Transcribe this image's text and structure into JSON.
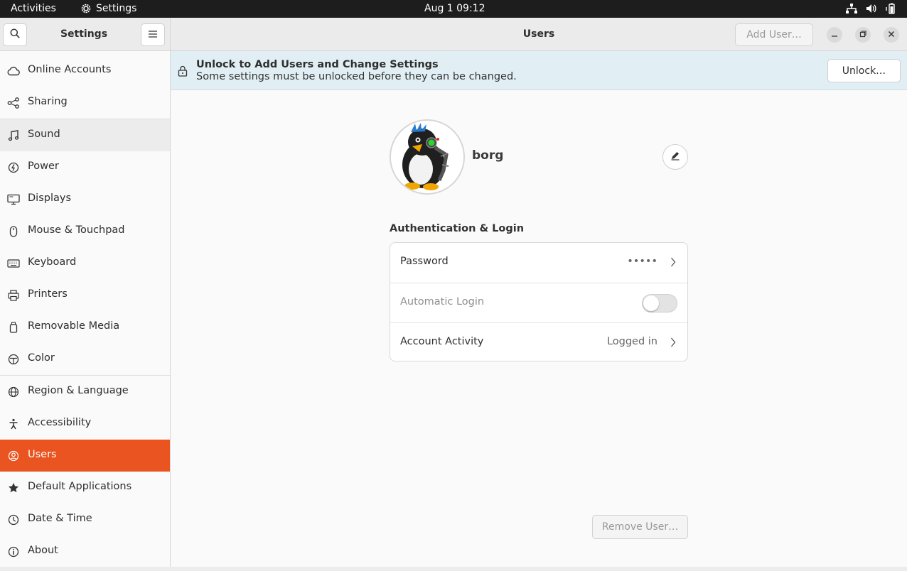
{
  "topbar": {
    "activities": "Activities",
    "app_name": "Settings",
    "clock": "Aug 1  09:12",
    "tray_icons": [
      "network-icon",
      "volume-icon",
      "battery-icon"
    ]
  },
  "header": {
    "sidebar_title": "Settings",
    "page_title": "Users",
    "add_user_label": "Add User…"
  },
  "sidebar": {
    "items": [
      {
        "label": "Online Accounts",
        "icon": "cloud-icon"
      },
      {
        "label": "Sharing",
        "icon": "share-icon"
      },
      {
        "label": "Sound",
        "icon": "music-note-icon"
      },
      {
        "label": "Power",
        "icon": "power-icon"
      },
      {
        "label": "Displays",
        "icon": "display-icon"
      },
      {
        "label": "Mouse & Touchpad",
        "icon": "mouse-icon"
      },
      {
        "label": "Keyboard",
        "icon": "keyboard-icon"
      },
      {
        "label": "Printers",
        "icon": "printer-icon"
      },
      {
        "label": "Removable Media",
        "icon": "usb-drive-icon"
      },
      {
        "label": "Color",
        "icon": "color-icon"
      },
      {
        "label": "Region & Language",
        "icon": "globe-icon"
      },
      {
        "label": "Accessibility",
        "icon": "accessibility-icon"
      },
      {
        "label": "Users",
        "icon": "user-icon"
      },
      {
        "label": "Default Applications",
        "icon": "star-icon"
      },
      {
        "label": "Date & Time",
        "icon": "clock-icon"
      },
      {
        "label": "About",
        "icon": "info-icon"
      }
    ],
    "active": "Users",
    "hovered": "Sound"
  },
  "banner": {
    "title": "Unlock to Add Users and Change Settings",
    "subtitle": "Some settings must be unlocked before they can be changed.",
    "unlock_label": "Unlock…"
  },
  "user": {
    "name": "borg"
  },
  "auth": {
    "section_title": "Authentication & Login",
    "password_label": "Password",
    "password_value": "•••••",
    "auto_login_label": "Automatic Login",
    "auto_login_enabled": false,
    "activity_label": "Account Activity",
    "activity_value": "Logged in"
  },
  "remove_user_label": "Remove User…",
  "colors": {
    "accent": "#e95420",
    "banner": "#e1eff4",
    "topbar": "#1d1d1d"
  }
}
